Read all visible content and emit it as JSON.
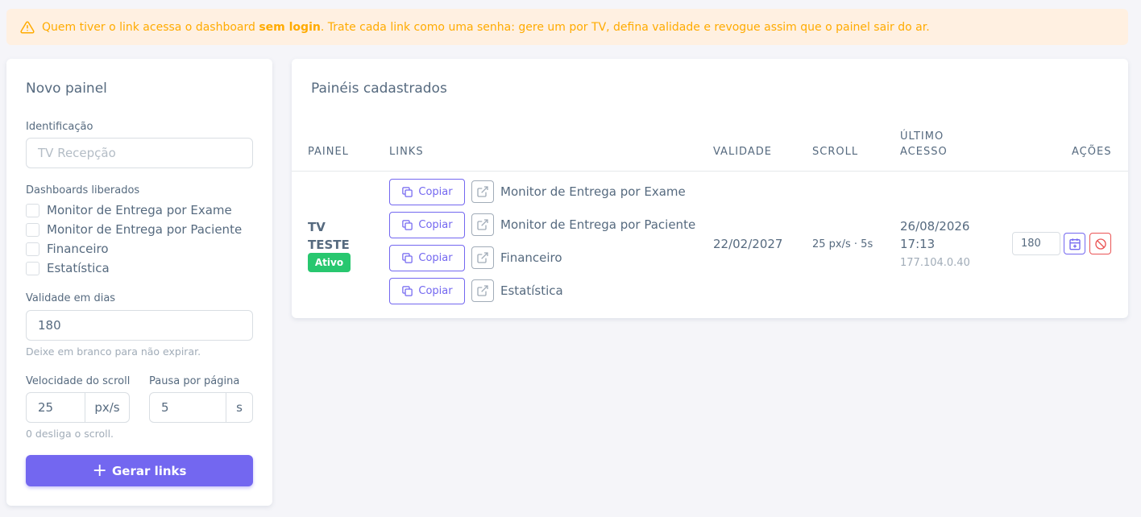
{
  "alert": {
    "text_before": "Quem tiver o link acessa o dashboard ",
    "text_bold": "sem login",
    "text_after": ". Trate cada link como uma senha: gere um por TV, defina validade e revogue assim que o painel sair do ar.",
    "color": "#ffab00",
    "icon": "warning-triangle-icon"
  },
  "form": {
    "title": "Novo painel",
    "identificacao_label": "Identificação",
    "identificacao_placeholder": "TV Recepção",
    "dashboards_label": "Dashboards liberados",
    "dashboards": [
      "Monitor de Entrega por Exame",
      "Monitor de Entrega por Paciente",
      "Financeiro",
      "Estatística"
    ],
    "validade_label": "Validade em dias",
    "validade_value": "180",
    "validade_hint": "Deixe em branco para não expirar.",
    "velocidade_label": "Velocidade do scroll",
    "velocidade_value": "25",
    "velocidade_unit": "px/s",
    "pausa_label": "Pausa por página",
    "pausa_value": "5",
    "pausa_unit": "s",
    "scroll_hint": "0 desliga o scroll.",
    "submit_label": "Gerar links",
    "accent": "#7367f0"
  },
  "table": {
    "title": "Painéis cadastrados",
    "headers": {
      "painel": "PAINEL",
      "links": "LINKS",
      "validade": "VALIDADE",
      "scroll": "SCROLL",
      "ultimo_acesso_1": "ÚLTIMO",
      "ultimo_acesso_2": "ACESSO",
      "acoes": "AÇÕES"
    },
    "rows": [
      {
        "painel_line1": "TV",
        "painel_line2": "TESTE",
        "status": "Ativo",
        "copy_label": "Copiar",
        "links": [
          "Monitor de Entrega por Exame",
          "Monitor de Entrega por Paciente",
          "Financeiro",
          "Estatística"
        ],
        "validade": "22/02/2027",
        "scroll": "25 px/s · 5s",
        "ultimo_acesso_date": "26/08/2026",
        "ultimo_acesso_time": "17:13",
        "ultimo_acesso_ip": "177.104.0.40",
        "renew_days": "180"
      }
    ]
  }
}
